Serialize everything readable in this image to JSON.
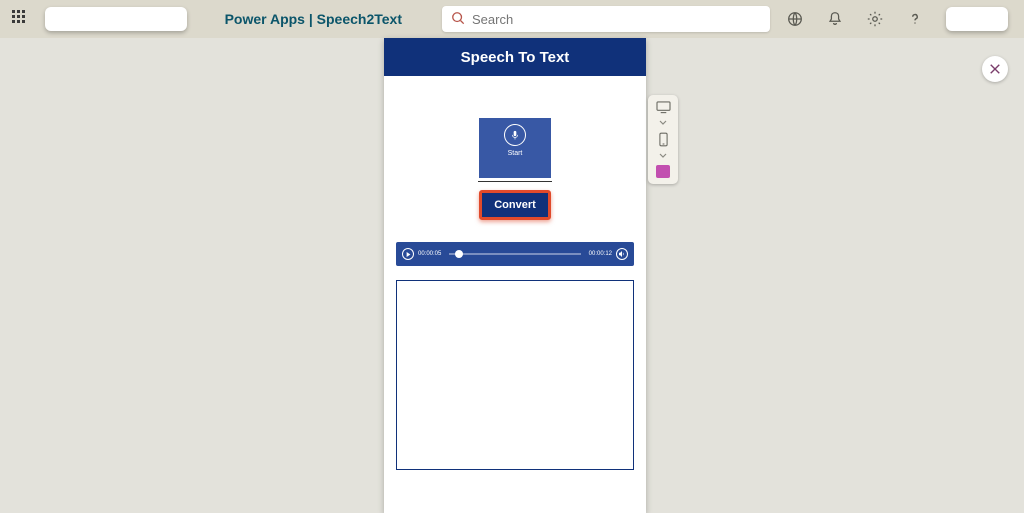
{
  "header": {
    "title": "Power Apps  |  Speech2Text",
    "search_placeholder": "Search"
  },
  "app": {
    "title": "Speech To Text",
    "mic_label": "Start",
    "convert_label": "Convert",
    "audio": {
      "current": "00:00:05",
      "total": "00:00:12"
    }
  }
}
